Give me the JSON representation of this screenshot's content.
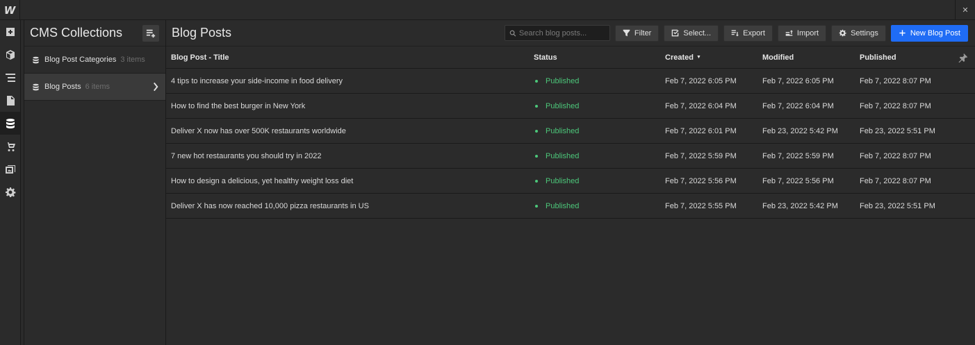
{
  "app": {
    "logo_text": "W",
    "close_glyph": "✕"
  },
  "rail": {
    "items": [
      {
        "icon": "add-panel-icon"
      },
      {
        "icon": "box-icon"
      },
      {
        "icon": "navigator-icon"
      },
      {
        "icon": "pages-icon"
      },
      {
        "icon": "cms-database-icon",
        "active": true
      },
      {
        "icon": "ecommerce-cart-icon"
      },
      {
        "icon": "assets-icon"
      },
      {
        "icon": "settings-gear-icon"
      }
    ]
  },
  "collections": {
    "title": "CMS Collections",
    "items": [
      {
        "name": "Blog Post Categories",
        "count": "3 items",
        "active": false
      },
      {
        "name": "Blog Posts",
        "count": "6 items",
        "active": true
      }
    ]
  },
  "main": {
    "title": "Blog Posts",
    "search_placeholder": "Search blog posts...",
    "buttons": {
      "filter": "Filter",
      "select": "Select...",
      "export": "Export",
      "import": "Import",
      "settings": "Settings",
      "new_post": "New Blog Post"
    },
    "columns": {
      "title": "Blog Post - Title",
      "status": "Status",
      "created": "Created",
      "modified": "Modified",
      "published": "Published"
    },
    "sort_glyph": "▼",
    "rows": [
      {
        "title": "4 tips to increase your side-income in food delivery",
        "status": "Published",
        "created": "Feb 7, 2022 6:05 PM",
        "modified": "Feb 7, 2022 6:05 PM",
        "published": "Feb 7, 2022 8:07 PM"
      },
      {
        "title": "How to find the best burger in New York",
        "status": "Published",
        "created": "Feb 7, 2022 6:04 PM",
        "modified": "Feb 7, 2022 6:04 PM",
        "published": "Feb 7, 2022 8:07 PM"
      },
      {
        "title": "Deliver X now has over 500K restaurants worldwide",
        "status": "Published",
        "created": "Feb 7, 2022 6:01 PM",
        "modified": "Feb 23, 2022 5:42 PM",
        "published": "Feb 23, 2022 5:51 PM"
      },
      {
        "title": "7 new hot restaurants you should try in 2022",
        "status": "Published",
        "created": "Feb 7, 2022 5:59 PM",
        "modified": "Feb 7, 2022 5:59 PM",
        "published": "Feb 7, 2022 8:07 PM"
      },
      {
        "title": "How to design a delicious, yet healthy weight loss diet",
        "status": "Published",
        "created": "Feb 7, 2022 5:56 PM",
        "modified": "Feb 7, 2022 5:56 PM",
        "published": "Feb 7, 2022 8:07 PM"
      },
      {
        "title": "Deliver X has now reached 10,000 pizza restaurants in US",
        "status": "Published",
        "created": "Feb 7, 2022 5:55 PM",
        "modified": "Feb 23, 2022 5:42 PM",
        "published": "Feb 23, 2022 5:51 PM"
      }
    ]
  },
  "colors": {
    "accent": "#1f6cf5",
    "published": "#4cc77a",
    "background": "#2b2b2b"
  }
}
